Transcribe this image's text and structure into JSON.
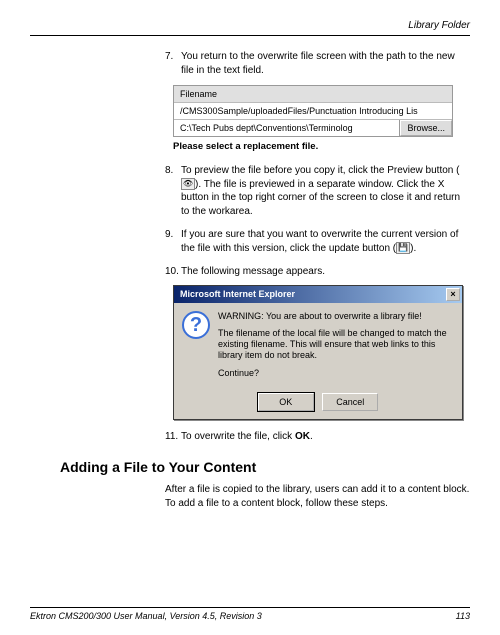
{
  "header": {
    "title": "Library Folder"
  },
  "steps": {
    "s7": {
      "num": "7.",
      "text": "You return to the overwrite file screen with the path to the new file in the text field."
    },
    "s8": {
      "num": "8.",
      "textA": "To preview the file before you copy it, click the Preview button (",
      "textB": "). The file is previewed in a separate window. Click the X button in the top right corner of the screen to close it and return to the workarea."
    },
    "s9": {
      "num": "9.",
      "textA": "If you are sure that you want to overwrite the current version of the file with this version, click the update button (",
      "textB": ")."
    },
    "s10": {
      "num": "10.",
      "text": "The following message appears."
    },
    "s11": {
      "num": "11.",
      "textA": "To overwrite the file, click ",
      "ok": "OK",
      "textB": "."
    }
  },
  "filebox": {
    "header": "Filename",
    "row1": "/CMS300Sample/uploadedFiles/Punctuation Introducing Lis",
    "row2": "C:\\Tech Pubs dept\\Conventions\\Terminolog",
    "browse": "Browse...",
    "select": "Please select a replacement file."
  },
  "dialog": {
    "title": "Microsoft Internet Explorer",
    "close": "×",
    "icon_glyph": "?",
    "line1": "WARNING: You are about to overwrite a library file!",
    "line2": "The filename of the local file will be changed to match the existing filename. This will ensure that web links to this library item do not break.",
    "line3": "Continue?",
    "ok": "OK",
    "cancel": "Cancel"
  },
  "section": {
    "heading": "Adding a File to Your Content",
    "para": "After a file is copied to the library, users can add it to a content block. To add a file to a content block, follow these steps."
  },
  "footer": {
    "left": "Ektron CMS200/300 User Manual, Version 4.5, Revision 3",
    "right": "113"
  }
}
